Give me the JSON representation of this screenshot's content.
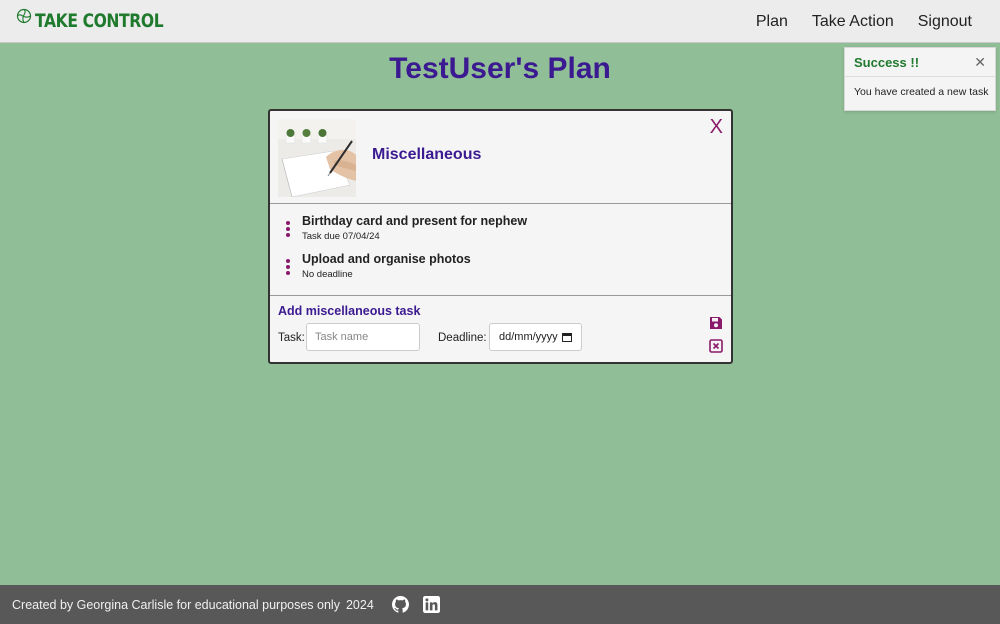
{
  "header": {
    "brand": "TAKE CONTROL",
    "nav": [
      "Plan",
      "Take Action",
      "Signout"
    ]
  },
  "page": {
    "title": "TestUser's Plan"
  },
  "toast": {
    "title": "Success !!",
    "close": "✕",
    "message": "You have created a new task"
  },
  "card": {
    "title": "Miscellaneous",
    "close": "X",
    "tasks": [
      {
        "name": "Birthday card and present for nephew",
        "due": "Task due 07/04/24"
      },
      {
        "name": "Upload and organise photos",
        "due": "No deadline"
      }
    ],
    "form": {
      "title": "Add miscellaneous task",
      "task_label": "Task:",
      "task_placeholder": "Task name",
      "task_value": "",
      "deadline_label": "Deadline:",
      "deadline_value": "dd/mm/yyyy"
    }
  },
  "footer": {
    "text": "Created by Georgina Carlisle for educational purposes only",
    "year": "2024",
    "icons": [
      "github-icon",
      "linkedin-icon"
    ]
  },
  "colors": {
    "background": "#90be96",
    "brand_green": "#1f7a2e",
    "title_purple": "#3b1a91",
    "accent_magenta": "#8b1a6b",
    "footer": "#585858"
  }
}
